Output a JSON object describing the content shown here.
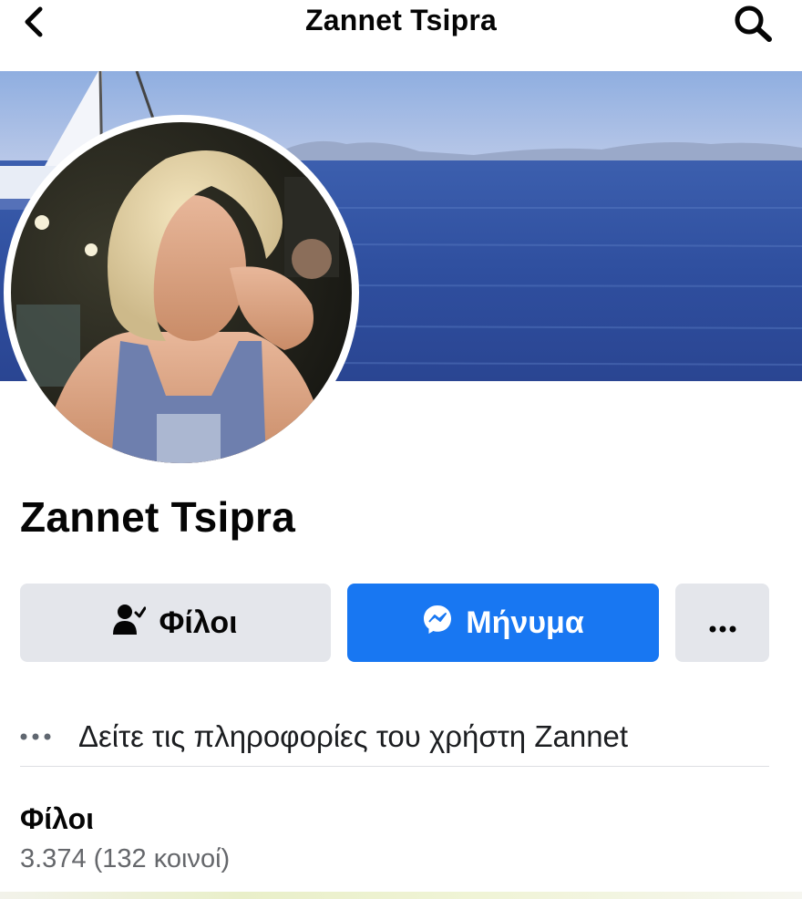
{
  "header": {
    "title": "Zannet Tsipra",
    "back_icon": "chevron-left-icon",
    "search_icon": "search-icon"
  },
  "profile": {
    "name": "Zannet Tsipra",
    "cover_photo": "sea-and-sailboat-photo",
    "avatar_photo": "profile-portrait-photo"
  },
  "actions": {
    "friends_label": "Φίλοι",
    "friends_icon": "friend-check-icon",
    "message_label": "Μήνυμα",
    "message_icon": "messenger-icon",
    "more_icon": "more-horizontal-icon"
  },
  "info": {
    "text": "Δείτε τις πληροφορίες του χρήστη Zannet",
    "icon": "more-horizontal-icon"
  },
  "friends_section": {
    "title": "Φίλοι",
    "count_text": "3.374 (132 κοινοί)"
  },
  "colors": {
    "primary": "#1877f2",
    "secondary_button": "#e4e6eb",
    "secondary_text": "#65676b"
  }
}
